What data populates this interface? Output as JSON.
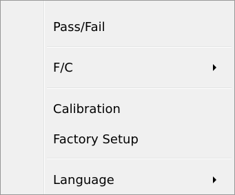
{
  "menu": {
    "items": [
      {
        "label": "Pass/Fail",
        "has_submenu": false
      },
      {
        "label": "F/C",
        "has_submenu": true,
        "submenu_icon": "chevron-right-icon"
      },
      {
        "label": "Calibration",
        "has_submenu": false
      },
      {
        "label": "Factory Setup",
        "has_submenu": false
      },
      {
        "label": "Language",
        "has_submenu": true,
        "submenu_icon": "chevron-right-icon"
      }
    ]
  },
  "colors": {
    "menu_background": "#f0f0f0",
    "menu_border": "#979797",
    "separator": "#e2e3e3",
    "text": "#000000"
  }
}
